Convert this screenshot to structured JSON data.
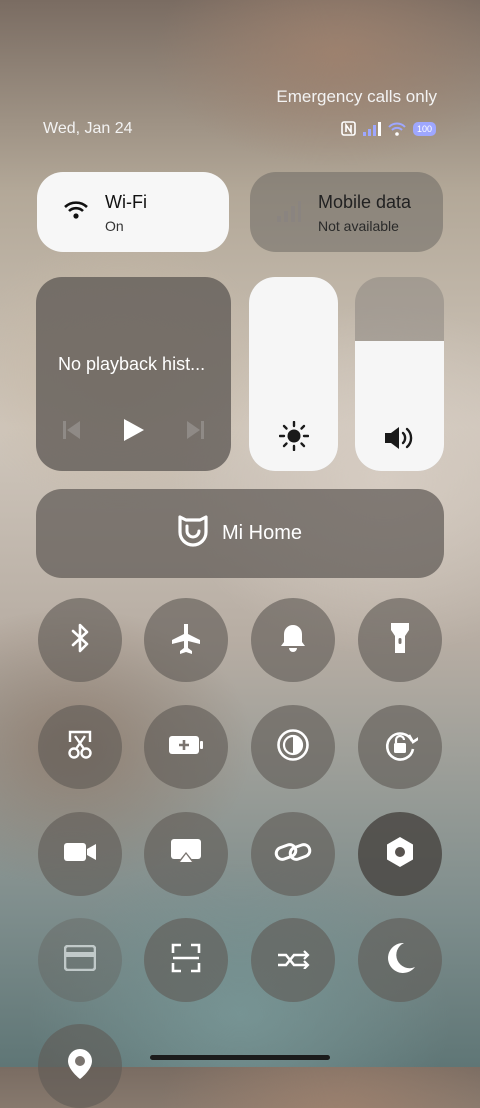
{
  "status": {
    "carrier_text": "Emergency calls only",
    "date": "Wed, Jan 24",
    "battery": "100",
    "icons": [
      "nfc-icon",
      "signal-icon",
      "wifi-icon",
      "battery-icon"
    ]
  },
  "wifi": {
    "title": "Wi-Fi",
    "subtitle": "On"
  },
  "mobile": {
    "title": "Mobile data",
    "subtitle": "Not available"
  },
  "media": {
    "title": "No playback hist..."
  },
  "brightness": {
    "level": 1.0
  },
  "volume": {
    "level": 0.67
  },
  "mihome": {
    "label": "Mi Home"
  },
  "toggles": [
    "bluetooth-icon",
    "airplane-icon",
    "bell-icon",
    "flashlight-icon",
    "screenshot-icon",
    "battery-saver-icon",
    "reading-mode-icon",
    "rotation-lock-icon",
    "video-camera-icon",
    "cast-icon",
    "link-icon",
    "hexagon-settings-icon",
    "card-icon",
    "scan-icon",
    "data-switch-icon",
    "dark-mode-icon",
    "location-icon"
  ]
}
